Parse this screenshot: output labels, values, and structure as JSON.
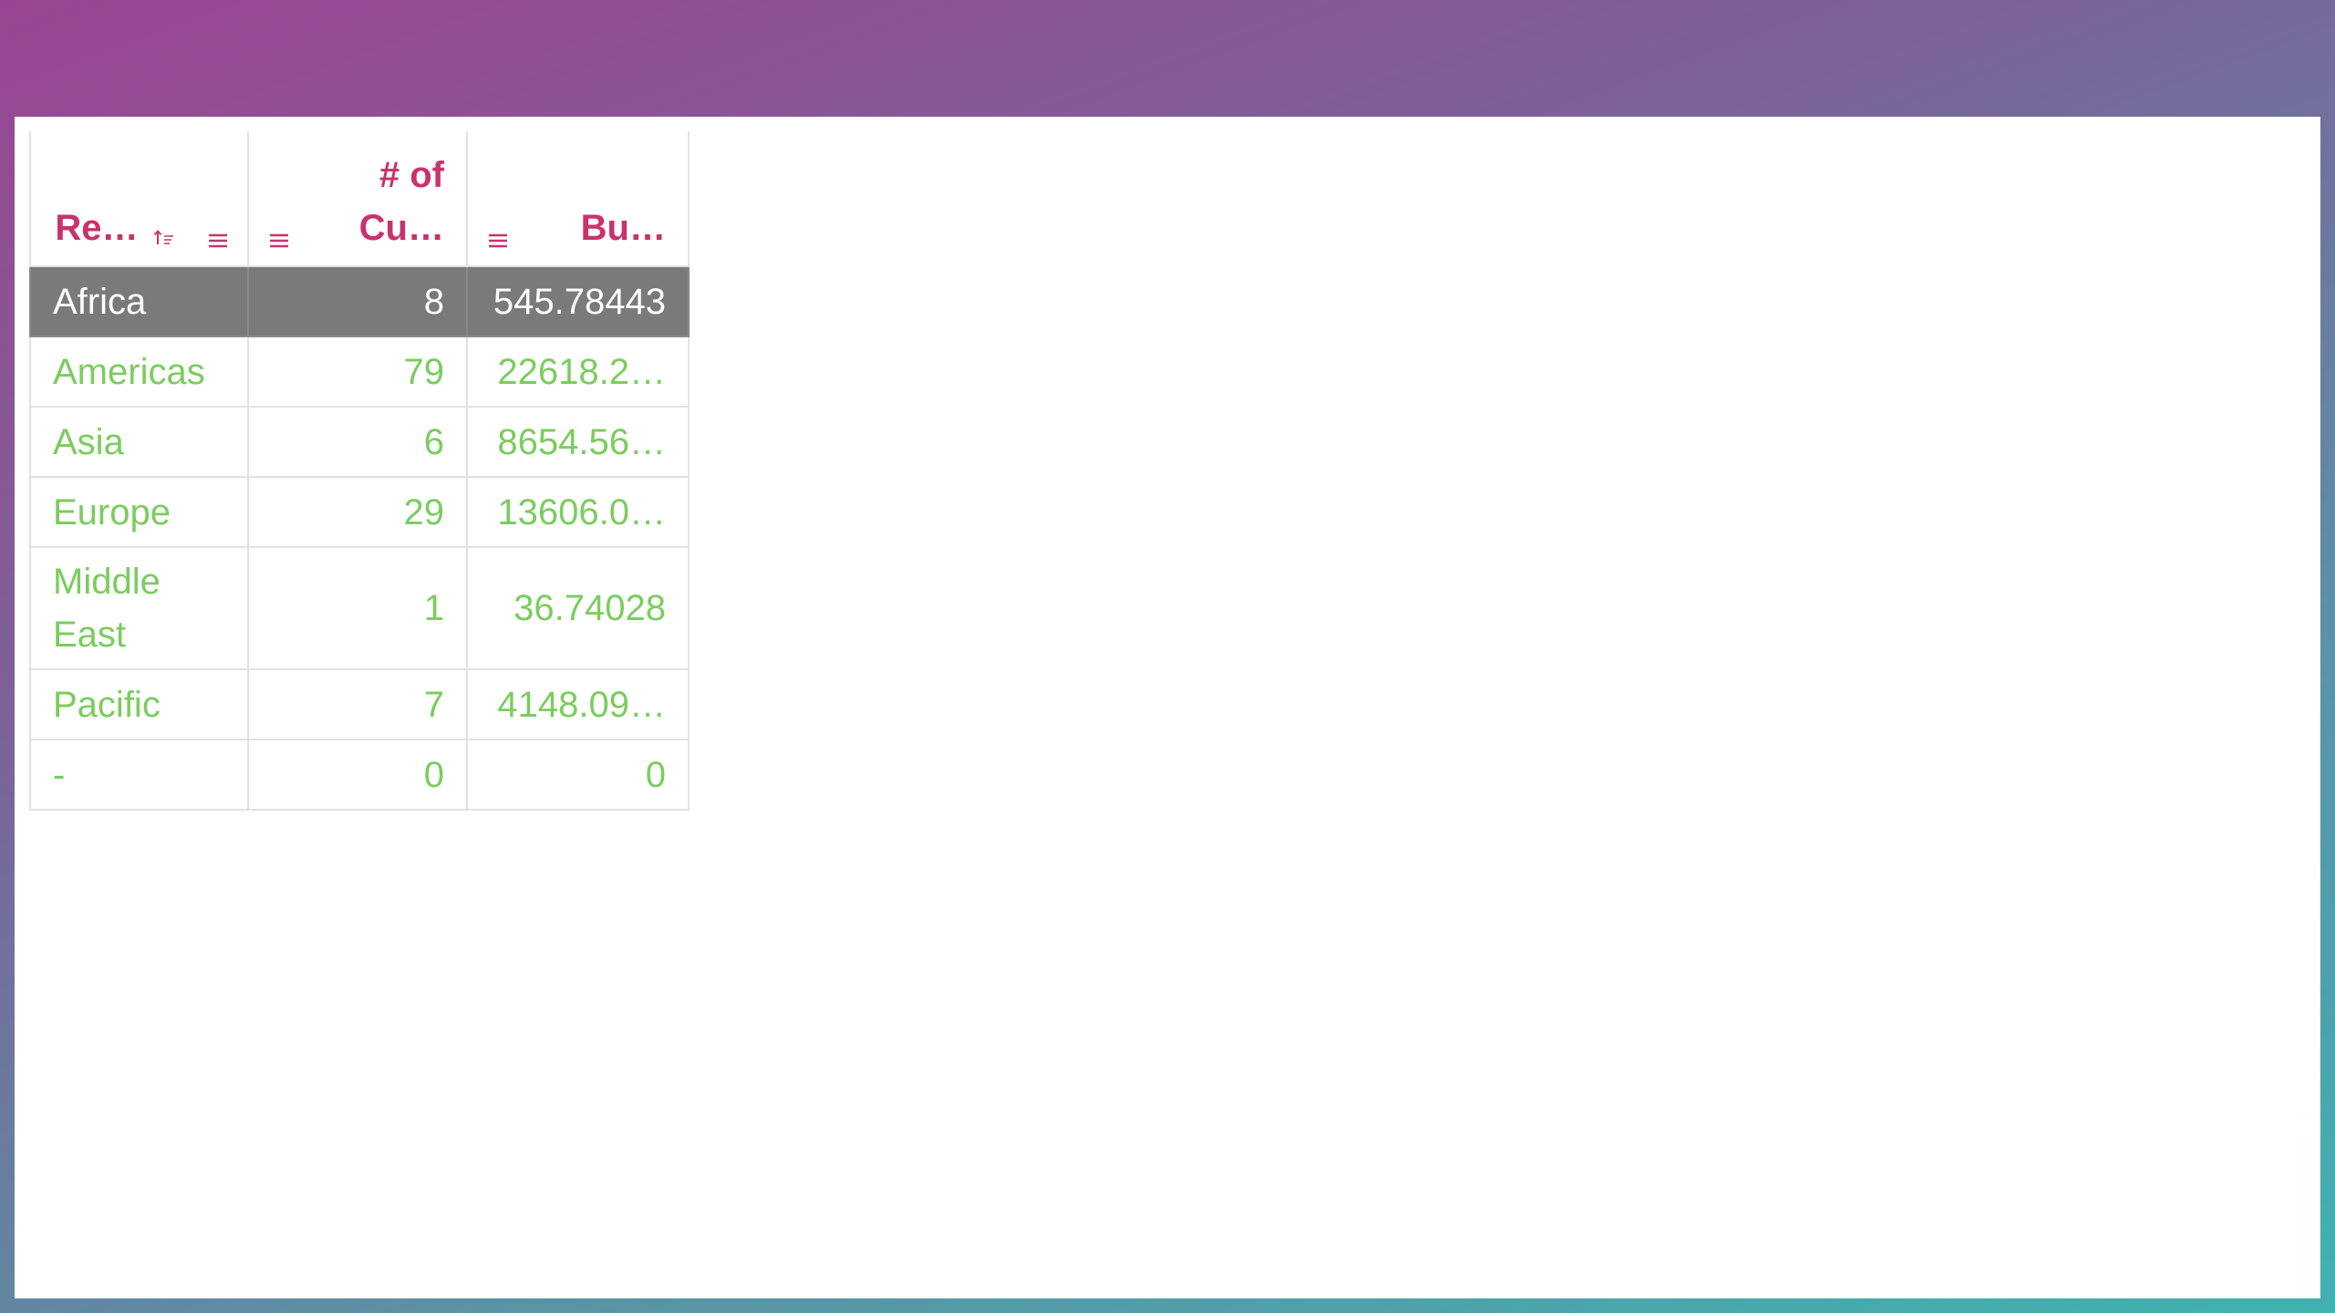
{
  "table": {
    "columns": [
      {
        "label": "Region",
        "display": "Re…",
        "sorted": "ascending"
      },
      {
        "label_line1": "# of",
        "label_line2": "Cu…",
        "display": "# of Cu…"
      },
      {
        "label": "Bu…",
        "display": "Bu…"
      }
    ],
    "rows": [
      {
        "region": "Africa",
        "count": "8",
        "value": "545.78443",
        "selected": true
      },
      {
        "region": "Americas",
        "count": "79",
        "value": "22618.2…",
        "selected": false
      },
      {
        "region": "Asia",
        "count": "6",
        "value": "8654.56…",
        "selected": false
      },
      {
        "region": "Europe",
        "count": "29",
        "value": "13606.0…",
        "selected": false
      },
      {
        "region": "Middle East",
        "count": "1",
        "value": "36.74028",
        "selected": false
      },
      {
        "region": "Pacific",
        "count": "7",
        "value": "4148.09…",
        "selected": false
      },
      {
        "region": "-",
        "count": "0",
        "value": "0",
        "selected": false
      }
    ]
  },
  "icons": {
    "sort": "sort-ascending-icon",
    "menu": "hamburger-menu-icon"
  },
  "colors": {
    "header_text": "#c8326e",
    "cell_text": "#7acd5e",
    "selected_row_bg": "#7a7a78",
    "selected_row_text": "#ffffff",
    "grid_lines": "#e2e2e2",
    "background_gradient_start": "#9a4593",
    "background_gradient_end": "#3fb2b0"
  }
}
